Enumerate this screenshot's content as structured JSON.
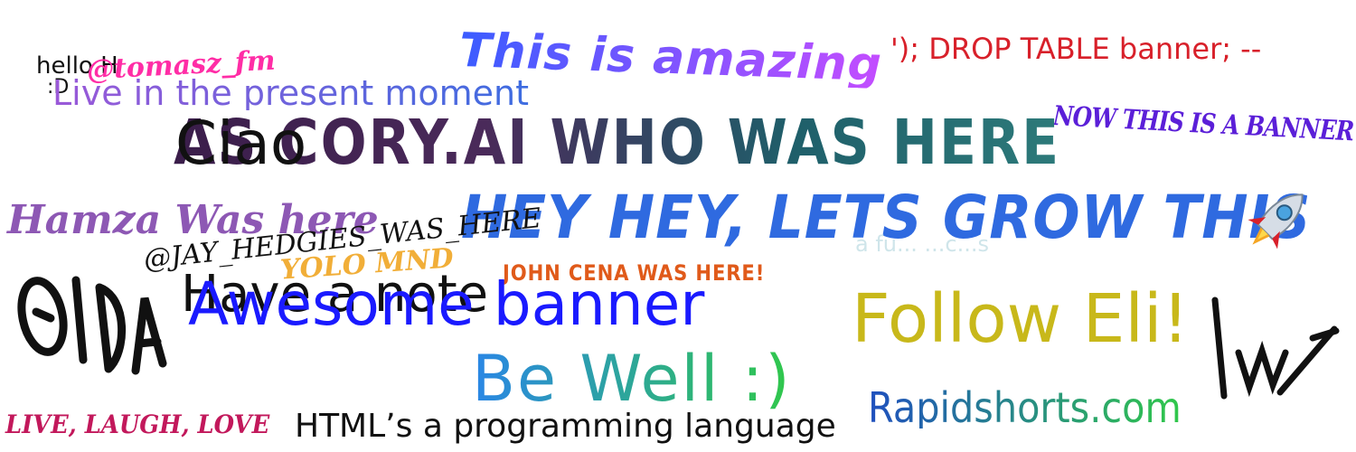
{
  "banner": {
    "texts": {
      "hello": "hello H",
      "colon_d": ":D",
      "handle": "@tomasz_fm",
      "present": "Live in the present moment",
      "amazing": "This is amazing",
      "drop_table": "'); DROP TABLE banner; --",
      "now_banner": "NOW THIS IS A BANNER",
      "ciao": "Ciao",
      "cory": "AS CORY.AI WHO WAS HERE",
      "hamza": "Hamza Was here",
      "hey_hey": "HEY HEY, LETS GROW THIS",
      "faint_right": "a fu... ...c...s",
      "jay": "@JAY_HEDGIES_WAS_HERE",
      "yolo": "YOLO MND",
      "john_cena": "JOHN CENA WAS HERE!",
      "have_a_note": "Have a note",
      "awesome": "Awesome banner",
      "follow_eli": "Follow Eli!",
      "be_well": "Be Well :)",
      "rapidshorts": "Rapidshorts.com",
      "live_laugh": "LIVE, LAUGH, LOVE",
      "html_lang": "HTML’s a programming language"
    },
    "icons": {
      "rocket": "rocket-icon"
    },
    "colors": {
      "present": "#8a4fe0",
      "handle": "#ff2da6",
      "amazing_from": "#3a5cff",
      "amazing_to": "#c44dff",
      "drop_table": "#d8202a",
      "now_banner": "#5b1fd8",
      "cory_from": "#3a1d4a",
      "cory_to": "#2d7a7a",
      "hamza": "#7a3ca8",
      "hey_hey": "#2f6ae0",
      "faint_right": "#cfe5ea",
      "yolo": "#f0a623",
      "john_cena": "#e05a1a",
      "awesome": "#1a1aff",
      "follow_eli": "#c8b81a",
      "be_well_from": "#2a86e6",
      "be_well_to": "#30c84a",
      "rapidshorts_from": "#1f4fbf",
      "rapidshorts_to": "#30c84a",
      "live_laugh": "#c2185b"
    }
  }
}
